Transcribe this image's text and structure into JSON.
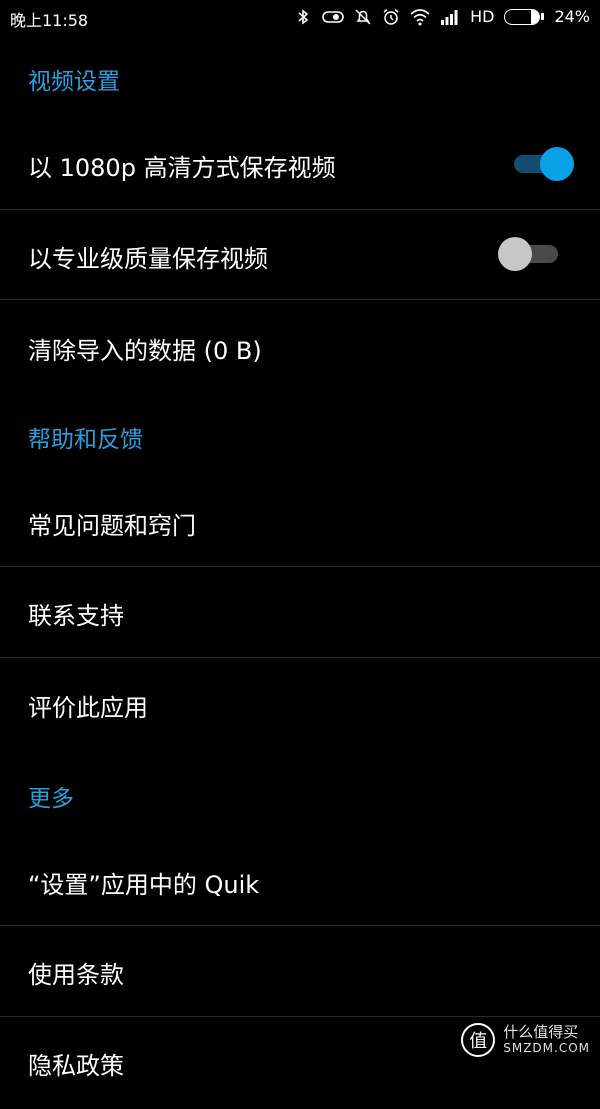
{
  "status_bar": {
    "time": "晚上11:58",
    "network": "HD",
    "battery": "24%",
    "battery_level": 0.24,
    "icons": [
      "bluetooth-icon",
      "data-saver-icon",
      "notification-muted-icon",
      "alarm-icon",
      "wifi-icon",
      "signal-icon",
      "battery-icon"
    ]
  },
  "sections": [
    {
      "header": "视频设置",
      "items": [
        {
          "label": "以 1080p 高清方式保存视频",
          "toggle": true
        },
        {
          "label": "以专业级质量保存视频",
          "toggle": false
        },
        {
          "label": "清除导入的数据 (0 B)"
        }
      ]
    },
    {
      "header": "帮助和反馈",
      "items": [
        {
          "label": "常见问题和窍门"
        },
        {
          "label": "联系支持"
        },
        {
          "label": "评价此应用"
        }
      ]
    },
    {
      "header": "更多",
      "items": [
        {
          "label": "“设置”应用中的 Quik"
        },
        {
          "label": "使用条款"
        },
        {
          "label": "隐私政策"
        }
      ]
    }
  ],
  "watermark": {
    "seal": "值",
    "line1": "什么值得买",
    "line2": "SMZDM.COM"
  },
  "colors": {
    "accent": "#2a9fe0",
    "toggle_on_thumb": "#0aa0e8",
    "toggle_on_track": "#0f4e72",
    "toggle_off_thumb": "#c7c7c7",
    "toggle_off_track": "#4a4a4a",
    "divider": "#2a2a2a"
  }
}
